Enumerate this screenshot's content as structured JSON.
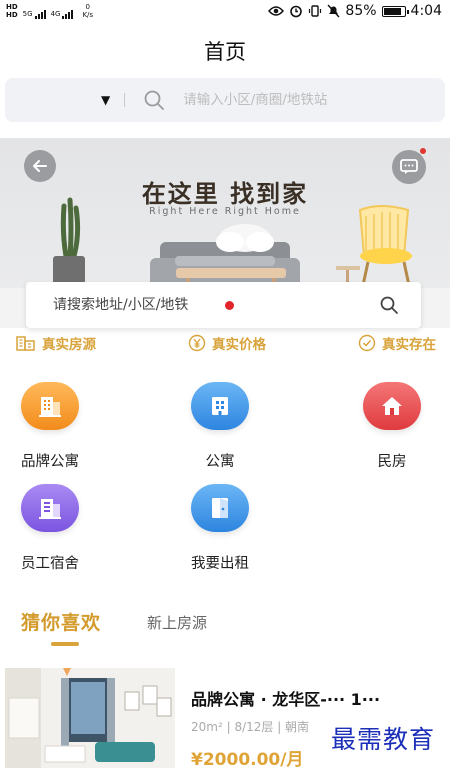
{
  "status_bar": {
    "hd_top": "HD",
    "hd_bottom": "HD",
    "network_1": "5G",
    "network_2": "4G",
    "speed_value": "0",
    "speed_unit": "K/s",
    "battery": "85%",
    "battery_level": 0.85,
    "time": "4:04"
  },
  "page": {
    "title": "首页"
  },
  "top_search": {
    "placeholder": "请输入小区/商圈/地铁站"
  },
  "banner": {
    "title": "在这里 找到家",
    "subtitle": "Right Here Right Home",
    "search_placeholder": "请搜索地址/小区/地铁"
  },
  "features": [
    {
      "label": "真实房源",
      "icon": "building-icon"
    },
    {
      "label": "真实价格",
      "icon": "yen-icon"
    },
    {
      "label": "真实存在",
      "icon": "check-circle-icon"
    }
  ],
  "categories": [
    {
      "label": "品牌公寓",
      "icon": "brand-apartment-icon",
      "color_top": "#ffb95a",
      "color_bottom": "#f28c1b"
    },
    {
      "label": "公寓",
      "icon": "apartment-icon",
      "color_top": "#6bb6f5",
      "color_bottom": "#2e86e0"
    },
    {
      "label": "民房",
      "icon": "house-icon",
      "color_top": "#f47677",
      "color_bottom": "#df3b3e"
    },
    {
      "label": "员工宿舍",
      "icon": "dormitory-icon",
      "color_top": "#a98af3",
      "color_bottom": "#7b55e0"
    },
    {
      "label": "我要出租",
      "icon": "door-icon",
      "color_top": "#6bb6f5",
      "color_bottom": "#2e86e0"
    }
  ],
  "tabs": {
    "active": "猜你喜欢",
    "inactive": "新上房源"
  },
  "listing": {
    "title": "品牌公寓 · 龙华区-··· 1···",
    "meta": "20m² | 8/12层 | 朝南",
    "price": "¥2000.00/月"
  },
  "watermark": "最需教育",
  "colors": {
    "accent_gold": "#d8a33a",
    "banner_dot": "#e1252a",
    "watermark_blue": "#1c2fb8"
  }
}
